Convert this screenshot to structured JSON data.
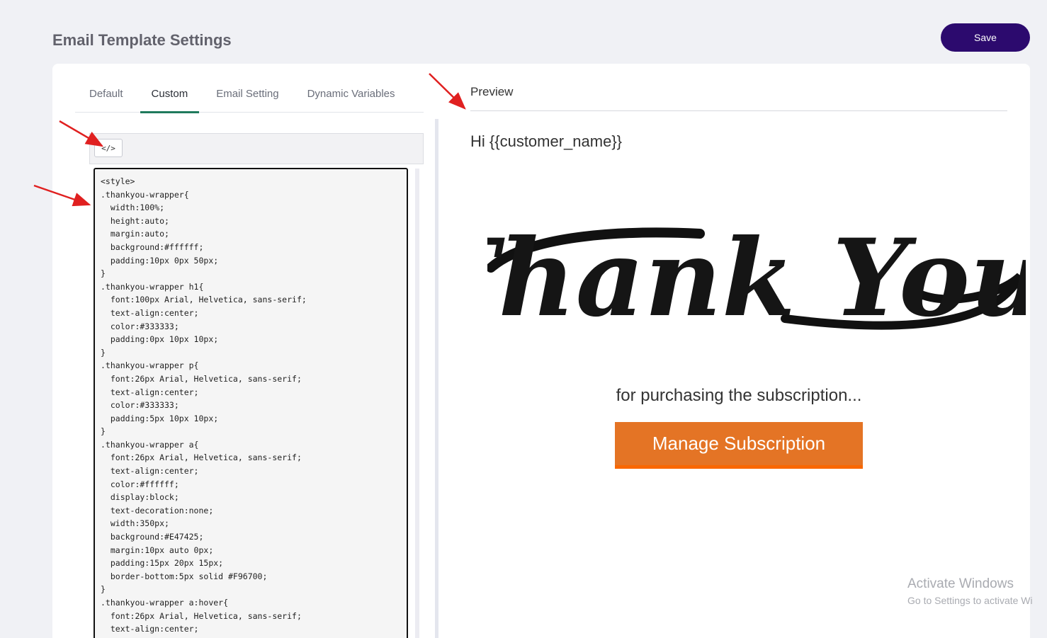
{
  "header": {
    "title": "Email Template Settings",
    "save_label": "Save"
  },
  "tabs": [
    {
      "label": "Default",
      "active": false
    },
    {
      "label": "Custom",
      "active": true
    },
    {
      "label": "Email Setting",
      "active": false
    },
    {
      "label": "Dynamic Variables",
      "active": false
    }
  ],
  "editor": {
    "code_toggle_label": "</>",
    "code_lines": [
      "<style>",
      ".thankyou-wrapper{",
      "  width:100%;",
      "  height:auto;",
      "  margin:auto;",
      "  background:#ffffff;",
      "  padding:10px 0px 50px;",
      "}",
      ".thankyou-wrapper h1{",
      "  font:100px Arial, Helvetica, sans-serif;",
      "  text-align:center;",
      "  color:#333333;",
      "  padding:0px 10px 10px;",
      "}",
      ".thankyou-wrapper p{",
      "  font:26px Arial, Helvetica, sans-serif;",
      "  text-align:center;",
      "  color:#333333;",
      "  padding:5px 10px 10px;",
      "}",
      ".thankyou-wrapper a{",
      "  font:26px Arial, Helvetica, sans-serif;",
      "  text-align:center;",
      "  color:#ffffff;",
      "  display:block;",
      "  text-decoration:none;",
      "  width:350px;",
      "  background:#E47425;",
      "  margin:10px auto 0px;",
      "  padding:15px 20px 15px;",
      "  border-bottom:5px solid #F96700;",
      "}",
      ".thankyou-wrapper a:hover{",
      "  font:26px Arial, Helvetica, sans-serif;",
      "  text-align:center;"
    ]
  },
  "preview": {
    "title": "Preview",
    "greeting": "Hi {{customer_name}}",
    "thank_you_art": "Thank You!",
    "subline": "for purchasing the subscription...",
    "button_label": "Manage Subscription",
    "button_color": "#E47425"
  },
  "watermark": {
    "line1": "Activate Windows",
    "line2": "Go to Settings to activate Wi"
  },
  "colors": {
    "accent": "#2c0a6e",
    "tab_active": "#1f7a5c",
    "annotation_arrow": "#e02020"
  }
}
